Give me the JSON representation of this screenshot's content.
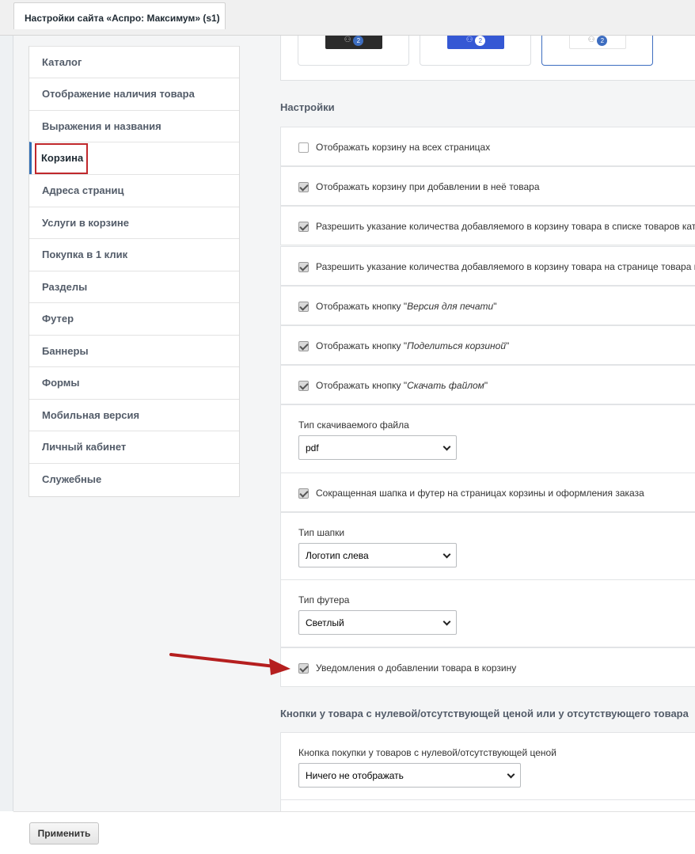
{
  "window": {
    "tab_title": "Настройки сайта «Аспро: Максимум» (s1)"
  },
  "sidebar": {
    "items": [
      {
        "label": "Каталог"
      },
      {
        "label": "Отображение наличия товара"
      },
      {
        "label": "Выражения и названия"
      },
      {
        "label": "Корзина",
        "active": true
      },
      {
        "label": "Адреса страниц"
      },
      {
        "label": "Услуги в корзине"
      },
      {
        "label": "Покупка в 1 клик"
      },
      {
        "label": "Разделы"
      },
      {
        "label": "Футер"
      },
      {
        "label": "Баннеры"
      },
      {
        "label": "Формы"
      },
      {
        "label": "Мобильная версия"
      },
      {
        "label": "Личный кабинет"
      },
      {
        "label": "Служебные"
      }
    ]
  },
  "cart_previews": [
    {
      "style": "dark",
      "badge": "2"
    },
    {
      "style": "blue",
      "badge": "2"
    },
    {
      "style": "light",
      "badge": "2",
      "selected": true
    }
  ],
  "settings": {
    "title": "Настройки",
    "show_cart_all_pages": {
      "label": "Отображать корзину на всех страницах",
      "checked": false
    },
    "show_cart_on_add": {
      "label": "Отображать корзину при добавлении в неё товара",
      "checked": true
    },
    "qty_in_list": {
      "label": "Разрешить указание количества добавляемого в корзину товара в списке товаров катал",
      "checked": true
    },
    "qty_on_page": {
      "label": "Разрешить указание количества добавляемого в корзину товара на странице товара ка",
      "checked": true
    },
    "print_button": {
      "label_prefix": "Отображать кнопку \"",
      "label_em": "Версия для печати",
      "label_suffix": "\"",
      "checked": true
    },
    "share_button": {
      "label_prefix": "Отображать кнопку \"",
      "label_em": "Поделиться корзиной",
      "label_suffix": "\"",
      "checked": true
    },
    "download_button": {
      "label_prefix": "Отображать кнопку \"",
      "label_em": "Скачать файлом",
      "label_suffix": "\"",
      "checked": true
    },
    "file_type": {
      "label": "Тип скачиваемого файла",
      "value": "pdf"
    },
    "short_header": {
      "label": "Сокращенная шапка и футер на страницах корзины и оформления заказа",
      "checked": true
    },
    "header_type": {
      "label": "Тип шапки",
      "value": "Логотип слева"
    },
    "footer_type": {
      "label": "Тип футера",
      "value": "Светлый"
    },
    "notifications": {
      "label": "Уведомления о добавлении товара в корзину",
      "checked": true
    }
  },
  "zero_price": {
    "title": "Кнопки у товара с нулевой/отсутствующей ценой или у отсутствующего товара",
    "buy_button": {
      "label": "Кнопка покупки у товаров с нулевой/отсутствующей ценой",
      "value": "Ничего не отображать"
    }
  },
  "footer": {
    "apply_label": "Применить"
  },
  "colors": {
    "accent_blue": "#2f6eb5",
    "highlight_red": "#c0282c",
    "arrow_red": "#b51f1f"
  }
}
